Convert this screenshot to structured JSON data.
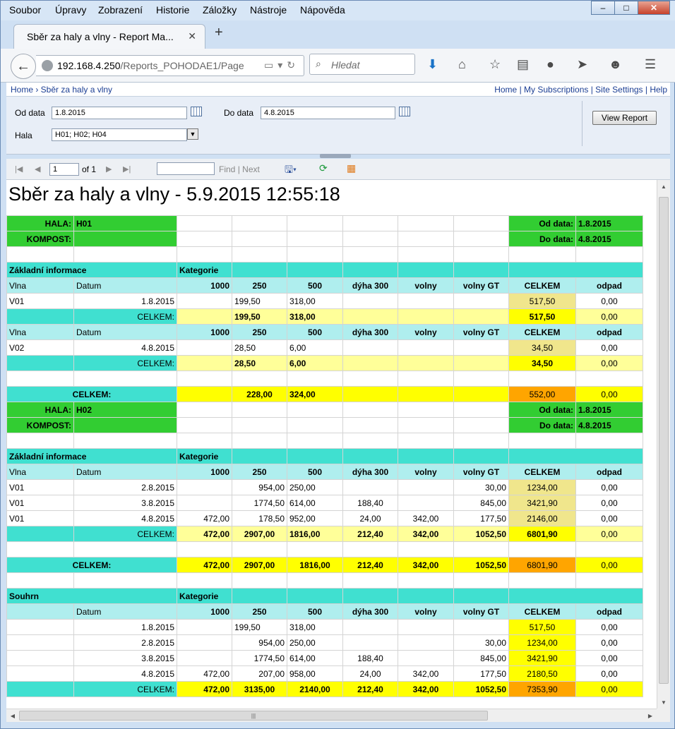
{
  "menubar": {
    "items": [
      "Soubor",
      "Úpravy",
      "Zobrazení",
      "Historie",
      "Záložky",
      "Nástroje",
      "Nápověda"
    ]
  },
  "window": {
    "minimize": "–",
    "maximize": "□",
    "close": "✕"
  },
  "tab": {
    "title": "Sběr za haly a vlny - Report Ma...",
    "close": "✕",
    "new": "+"
  },
  "nav": {
    "url_host": "192.168.4.250",
    "url_path": "/Reports_POHODAE1/Page",
    "search_placeholder": "Hledat"
  },
  "breadcrumb": {
    "left": "Home › Sběr za haly a vlny",
    "right": "Home | My Subscriptions | Site Settings | Help"
  },
  "params": {
    "od_label": "Od data",
    "od_value": "1.8.2015",
    "do_label": "Do data",
    "do_value": "4.8.2015",
    "hala_label": "Hala",
    "hala_value": "H01; H02; H04",
    "view_report": "View Report"
  },
  "toolbar": {
    "page": "1",
    "of": "of 1",
    "find": "Find",
    "sep": "|",
    "next": "Next"
  },
  "report": {
    "title": "Sběr za haly a vlny - 5.9.2015 12:55:18",
    "rows": [
      [
        [
          "HALA:",
          "g b r"
        ],
        [
          "H01",
          "g b"
        ],
        [
          "",
          "w"
        ],
        [
          "",
          "w"
        ],
        [
          "",
          "w"
        ],
        [
          "",
          "w"
        ],
        [
          "",
          "w"
        ],
        [
          "",
          "w"
        ],
        [
          "Od data:",
          "g b r"
        ],
        [
          "1.8.2015",
          "g b"
        ]
      ],
      [
        [
          "KOMPOST:",
          "g b r"
        ],
        [
          "",
          "g"
        ],
        [
          "",
          "w"
        ],
        [
          "",
          "w"
        ],
        [
          "",
          "w"
        ],
        [
          "",
          "w"
        ],
        [
          "",
          "w"
        ],
        [
          "",
          "w"
        ],
        [
          "Do data:",
          "g b r"
        ],
        [
          "4.8.2015",
          "g b"
        ]
      ],
      [
        [
          "",
          "w"
        ],
        [
          "",
          "w"
        ],
        [
          "",
          "w"
        ],
        [
          "",
          "w"
        ],
        [
          "",
          "w"
        ],
        [
          "",
          "w"
        ],
        [
          "",
          "w"
        ],
        [
          "",
          "w"
        ],
        [
          "",
          "w"
        ],
        [
          "",
          "w"
        ]
      ],
      [
        [
          "Základní informace",
          "tq b",
          2
        ],
        [
          "Kategorie",
          "tq b"
        ],
        [
          "",
          "tq"
        ],
        [
          "",
          "tq"
        ],
        [
          "",
          "tq"
        ],
        [
          "",
          "tq"
        ],
        [
          "",
          "tq"
        ],
        [
          "",
          "tq",
          2
        ]
      ],
      [
        [
          "Vlna",
          "lt"
        ],
        [
          "Datum",
          "lt"
        ],
        [
          "1000",
          "lt b r"
        ],
        [
          "250",
          "lt b c"
        ],
        [
          "500",
          "lt b c"
        ],
        [
          "dýha 300",
          "lt b c"
        ],
        [
          "volny",
          "lt b c"
        ],
        [
          "volny GT",
          "lt b c"
        ],
        [
          "CELKEM",
          "lt b c"
        ],
        [
          "odpad",
          "lt b c"
        ]
      ],
      [
        [
          "V01",
          "w"
        ],
        [
          "1.8.2015",
          "w r"
        ],
        [
          "",
          "w"
        ],
        [
          "199,50",
          "w"
        ],
        [
          "318,00",
          "w"
        ],
        [
          "",
          "w"
        ],
        [
          "",
          "w"
        ],
        [
          "",
          "w"
        ],
        [
          "517,50",
          "kh c"
        ],
        [
          "0,00",
          "w c"
        ]
      ],
      [
        [
          "",
          "tq"
        ],
        [
          "CELKEM:",
          "tq r"
        ],
        [
          "",
          "ly"
        ],
        [
          "199,50",
          "ly b"
        ],
        [
          "318,00",
          "ly b"
        ],
        [
          "",
          "ly"
        ],
        [
          "",
          "ly"
        ],
        [
          "",
          "ly"
        ],
        [
          "517,50",
          "y b c"
        ],
        [
          "0,00",
          "ly c"
        ]
      ],
      [
        [
          "Vlna",
          "lt"
        ],
        [
          "Datum",
          "lt"
        ],
        [
          "1000",
          "lt b r"
        ],
        [
          "250",
          "lt b c"
        ],
        [
          "500",
          "lt b c"
        ],
        [
          "dýha 300",
          "lt b c"
        ],
        [
          "volny",
          "lt b c"
        ],
        [
          "volny GT",
          "lt b c"
        ],
        [
          "CELKEM",
          "lt b c"
        ],
        [
          "odpad",
          "lt b c"
        ]
      ],
      [
        [
          "V02",
          "w"
        ],
        [
          "4.8.2015",
          "w r"
        ],
        [
          "",
          "w"
        ],
        [
          "28,50",
          "w"
        ],
        [
          "6,00",
          "w"
        ],
        [
          "",
          "w"
        ],
        [
          "",
          "w"
        ],
        [
          "",
          "w"
        ],
        [
          "34,50",
          "kh c"
        ],
        [
          "0,00",
          "w c"
        ]
      ],
      [
        [
          "",
          "tq"
        ],
        [
          "CELKEM:",
          "tq r"
        ],
        [
          "",
          "ly"
        ],
        [
          "28,50",
          "ly b"
        ],
        [
          "6,00",
          "ly b"
        ],
        [
          "",
          "ly"
        ],
        [
          "",
          "ly"
        ],
        [
          "",
          "ly"
        ],
        [
          "34,50",
          "y b c"
        ],
        [
          "0,00",
          "ly c"
        ]
      ],
      [
        [
          "",
          "w"
        ],
        [
          "",
          "w"
        ],
        [
          "",
          "w"
        ],
        [
          "",
          "w"
        ],
        [
          "",
          "w"
        ],
        [
          "",
          "w"
        ],
        [
          "",
          "w"
        ],
        [
          "",
          "w"
        ],
        [
          "",
          "w"
        ],
        [
          "",
          "w"
        ]
      ],
      [
        [
          "CELKEM:",
          "tq b c",
          2
        ],
        [
          "",
          "y"
        ],
        [
          "228,00",
          "y b c"
        ],
        [
          "324,00",
          "y b"
        ],
        [
          "",
          "y"
        ],
        [
          "",
          "y"
        ],
        [
          "",
          "y"
        ],
        [
          "552,00",
          "or c"
        ],
        [
          "0,00",
          "y c"
        ]
      ],
      [
        [
          "HALA:",
          "g b r"
        ],
        [
          "H02",
          "g b"
        ],
        [
          "",
          "w"
        ],
        [
          "",
          "w"
        ],
        [
          "",
          "w"
        ],
        [
          "",
          "w"
        ],
        [
          "",
          "w"
        ],
        [
          "",
          "w"
        ],
        [
          "Od data:",
          "g b r"
        ],
        [
          "1.8.2015",
          "g b"
        ]
      ],
      [
        [
          "KOMPOST:",
          "g b r"
        ],
        [
          "",
          "g"
        ],
        [
          "",
          "w"
        ],
        [
          "",
          "w"
        ],
        [
          "",
          "w"
        ],
        [
          "",
          "w"
        ],
        [
          "",
          "w"
        ],
        [
          "",
          "w"
        ],
        [
          "Do data:",
          "g b r"
        ],
        [
          "4.8.2015",
          "g b"
        ]
      ],
      [
        [
          "",
          "w"
        ],
        [
          "",
          "w"
        ],
        [
          "",
          "w"
        ],
        [
          "",
          "w"
        ],
        [
          "",
          "w"
        ],
        [
          "",
          "w"
        ],
        [
          "",
          "w"
        ],
        [
          "",
          "w"
        ],
        [
          "",
          "w"
        ],
        [
          "",
          "w"
        ]
      ],
      [
        [
          "Základní informace",
          "tq b",
          2
        ],
        [
          "Kategorie",
          "tq b"
        ],
        [
          "",
          "tq"
        ],
        [
          "",
          "tq"
        ],
        [
          "",
          "tq"
        ],
        [
          "",
          "tq"
        ],
        [
          "",
          "tq"
        ],
        [
          "",
          "tq",
          2
        ]
      ],
      [
        [
          "Vlna",
          "lt"
        ],
        [
          "Datum",
          "lt"
        ],
        [
          "1000",
          "lt b r"
        ],
        [
          "250",
          "lt b c"
        ],
        [
          "500",
          "lt b c"
        ],
        [
          "dýha 300",
          "lt b c"
        ],
        [
          "volny",
          "lt b c"
        ],
        [
          "volny GT",
          "lt b c"
        ],
        [
          "CELKEM",
          "lt b c"
        ],
        [
          "odpad",
          "lt b c"
        ]
      ],
      [
        [
          "V01",
          "w"
        ],
        [
          "2.8.2015",
          "w r"
        ],
        [
          "",
          "w"
        ],
        [
          "954,00",
          "w r"
        ],
        [
          "250,00",
          "w"
        ],
        [
          "",
          "w"
        ],
        [
          "",
          "w"
        ],
        [
          "30,00",
          "w r"
        ],
        [
          "1234,00",
          "kh c"
        ],
        [
          "0,00",
          "w c"
        ]
      ],
      [
        [
          "V01",
          "w"
        ],
        [
          "3.8.2015",
          "w r"
        ],
        [
          "",
          "w"
        ],
        [
          "1774,50",
          "w r"
        ],
        [
          "614,00",
          "w"
        ],
        [
          "188,40",
          "w c"
        ],
        [
          "",
          "w"
        ],
        [
          "845,00",
          "w r"
        ],
        [
          "3421,90",
          "kh c"
        ],
        [
          "0,00",
          "w c"
        ]
      ],
      [
        [
          "V01",
          "w"
        ],
        [
          "4.8.2015",
          "w r"
        ],
        [
          "472,00",
          "w r"
        ],
        [
          "178,50",
          "w r"
        ],
        [
          "952,00",
          "w"
        ],
        [
          "24,00",
          "w c"
        ],
        [
          "342,00",
          "w c"
        ],
        [
          "177,50",
          "w r"
        ],
        [
          "2146,00",
          "kh c"
        ],
        [
          "0,00",
          "w c"
        ]
      ],
      [
        [
          "",
          "tq"
        ],
        [
          "CELKEM:",
          "tq r"
        ],
        [
          "472,00",
          "ly b r"
        ],
        [
          "2907,00",
          "ly b c"
        ],
        [
          "1816,00",
          "ly b"
        ],
        [
          "212,40",
          "ly b c"
        ],
        [
          "342,00",
          "ly b c"
        ],
        [
          "1052,50",
          "ly b r"
        ],
        [
          "6801,90",
          "y b c"
        ],
        [
          "0,00",
          "ly c"
        ]
      ],
      [
        [
          "",
          "w"
        ],
        [
          "",
          "w"
        ],
        [
          "",
          "w"
        ],
        [
          "",
          "w"
        ],
        [
          "",
          "w"
        ],
        [
          "",
          "w"
        ],
        [
          "",
          "w"
        ],
        [
          "",
          "w"
        ],
        [
          "",
          "w"
        ],
        [
          "",
          "w"
        ]
      ],
      [
        [
          "CELKEM:",
          "tq b c",
          2
        ],
        [
          "472,00",
          "y b r"
        ],
        [
          "2907,00",
          "y b c"
        ],
        [
          "1816,00",
          "y b c"
        ],
        [
          "212,40",
          "y b c"
        ],
        [
          "342,00",
          "y b c"
        ],
        [
          "1052,50",
          "y b r"
        ],
        [
          "6801,90",
          "or c"
        ],
        [
          "0,00",
          "y c"
        ]
      ],
      [
        [
          "",
          "w"
        ],
        [
          "",
          "w"
        ],
        [
          "",
          "w"
        ],
        [
          "",
          "w"
        ],
        [
          "",
          "w"
        ],
        [
          "",
          "w"
        ],
        [
          "",
          "w"
        ],
        [
          "",
          "w"
        ],
        [
          "",
          "w"
        ],
        [
          "",
          "w"
        ]
      ],
      [
        [
          "Souhrn",
          "tq b",
          2
        ],
        [
          "Kategorie",
          "tq b"
        ],
        [
          "",
          "tq"
        ],
        [
          "",
          "tq"
        ],
        [
          "",
          "tq"
        ],
        [
          "",
          "tq"
        ],
        [
          "",
          "tq"
        ],
        [
          "",
          "tq",
          2
        ]
      ],
      [
        [
          "",
          "lt"
        ],
        [
          "Datum",
          "lt"
        ],
        [
          "1000",
          "lt b r"
        ],
        [
          "250",
          "lt b c"
        ],
        [
          "500",
          "lt b c"
        ],
        [
          "dýha 300",
          "lt b c"
        ],
        [
          "volny",
          "lt b c"
        ],
        [
          "volny GT",
          "lt b c"
        ],
        [
          "CELKEM",
          "lt b c"
        ],
        [
          "odpad",
          "lt b c"
        ]
      ],
      [
        [
          "",
          "w"
        ],
        [
          "1.8.2015",
          "w r"
        ],
        [
          "",
          "w"
        ],
        [
          "199,50",
          "w"
        ],
        [
          "318,00",
          "w"
        ],
        [
          "",
          "w"
        ],
        [
          "",
          "w"
        ],
        [
          "",
          "w"
        ],
        [
          "517,50",
          "y c"
        ],
        [
          "0,00",
          "w c"
        ]
      ],
      [
        [
          "",
          "w"
        ],
        [
          "2.8.2015",
          "w r"
        ],
        [
          "",
          "w"
        ],
        [
          "954,00",
          "w r"
        ],
        [
          "250,00",
          "w"
        ],
        [
          "",
          "w"
        ],
        [
          "",
          "w"
        ],
        [
          "30,00",
          "w r"
        ],
        [
          "1234,00",
          "y c"
        ],
        [
          "0,00",
          "w c"
        ]
      ],
      [
        [
          "",
          "w"
        ],
        [
          "3.8.2015",
          "w r"
        ],
        [
          "",
          "w"
        ],
        [
          "1774,50",
          "w r"
        ],
        [
          "614,00",
          "w"
        ],
        [
          "188,40",
          "w c"
        ],
        [
          "",
          "w"
        ],
        [
          "845,00",
          "w r"
        ],
        [
          "3421,90",
          "y c"
        ],
        [
          "0,00",
          "w c"
        ]
      ],
      [
        [
          "",
          "w"
        ],
        [
          "4.8.2015",
          "w r"
        ],
        [
          "472,00",
          "w r"
        ],
        [
          "207,00",
          "w r"
        ],
        [
          "958,00",
          "w"
        ],
        [
          "24,00",
          "w c"
        ],
        [
          "342,00",
          "w c"
        ],
        [
          "177,50",
          "w r"
        ],
        [
          "2180,50",
          "y c"
        ],
        [
          "0,00",
          "w c"
        ]
      ],
      [
        [
          "",
          "tq"
        ],
        [
          "CELKEM:",
          "tq r"
        ],
        [
          "472,00",
          "y b r"
        ],
        [
          "3135,00",
          "y b c"
        ],
        [
          "2140,00",
          "y b c"
        ],
        [
          "212,40",
          "y b c"
        ],
        [
          "342,00",
          "y b c"
        ],
        [
          "1052,50",
          "y b r"
        ],
        [
          "7353,90",
          "or c"
        ],
        [
          "0,00",
          "y c"
        ]
      ]
    ]
  }
}
